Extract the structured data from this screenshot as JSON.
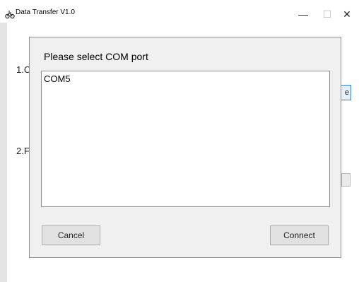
{
  "window": {
    "title": "Data Transfer V1.0",
    "controls": {
      "minimize": "—",
      "maximize": "☐",
      "close": "✕"
    }
  },
  "background": {
    "label_1": "1.C",
    "label_2": "2.F",
    "button_1_text": "e"
  },
  "dialog": {
    "title": "Please select COM port",
    "ports": [
      "COM5"
    ],
    "cancel_label": "Cancel",
    "connect_label": "Connect"
  }
}
